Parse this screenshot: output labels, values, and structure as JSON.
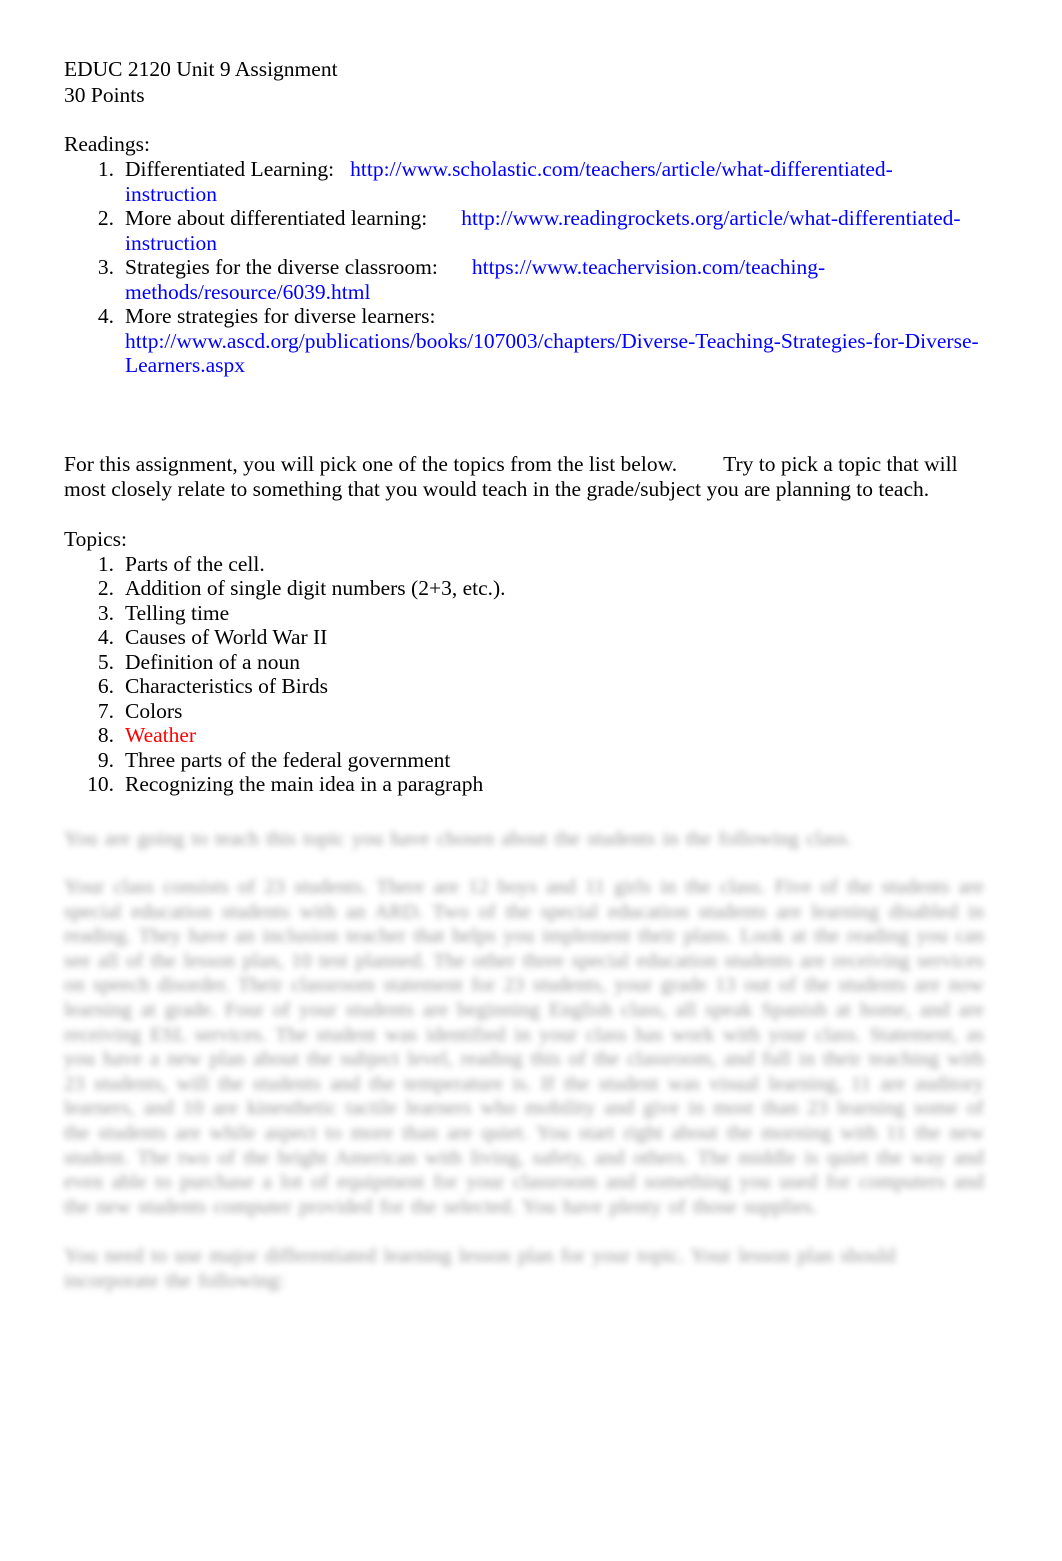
{
  "document": {
    "heading": {
      "course_line": "EDUC 2120 Unit 9 Assignment",
      "points_line": "30 Points"
    },
    "readings": {
      "label": "Readings:",
      "items": [
        {
          "number": "1.",
          "label": "Differentiated Learning:",
          "url": "http://www.scholastic.com/teachers/article/what-differentiated-instruction"
        },
        {
          "number": "2.",
          "label": "More about differentiated learning:",
          "url": "http://www.readingrockets.org/article/what-differentiated-instruction"
        },
        {
          "number": "3.",
          "label": "Strategies for the diverse classroom:",
          "url": "https://www.teachervision.com/teaching-methods/resource/6039.html"
        },
        {
          "number": "4.",
          "label": "More strategies for diverse learners:",
          "url": "http://www.ascd.org/publications/books/107003/chapters/Diverse-Teaching-Strategies-for-Diverse-Learners.aspx"
        }
      ]
    },
    "instructions": {
      "sentence_1": "For this assignment, you will pick one of the topics from the list below.",
      "sentence_2": "Try to pick a topic that will most closely relate to something that you would teach in the grade/subject you are planning to teach."
    },
    "topics": {
      "label": "Topics:",
      "items": [
        {
          "number": "1.",
          "text": "Parts of the cell.",
          "color": "#000000"
        },
        {
          "number": "2.",
          "text": "Addition of single digit numbers (2+3, etc.).",
          "color": "#000000"
        },
        {
          "number": "3.",
          "text": "Telling time",
          "color": "#000000"
        },
        {
          "number": "4.",
          "text": "Causes of World War II",
          "color": "#000000"
        },
        {
          "number": "5.",
          "text": "Definition of a noun",
          "color": "#000000"
        },
        {
          "number": "6.",
          "text": "Characteristics of Birds",
          "color": "#000000"
        },
        {
          "number": "7.",
          "text": "Colors",
          "color": "#000000"
        },
        {
          "number": "8.",
          "text": "Weather",
          "color": "#ff0000"
        },
        {
          "number": "9.",
          "text": "Three parts of the federal government",
          "color": "#000000"
        },
        {
          "number": "10.",
          "text": "Recognizing the main idea in a paragraph",
          "color": "#000000"
        }
      ]
    },
    "redacted": {
      "note": "blurred-illegible",
      "paragraph_1": "You are going to teach this topic you have chosen about the students in the following class.",
      "paragraph_2": "Your class consists of 23 students. There are 12 boys and 11 girls in the class. Five of the students are special education students with an ARD. Two of the special education students are learning disabled in reading. They have an inclusion teacher that helps you implement their plans. Look at the reading you can see all of the lesson plan, 10 test planned. The other three special education students are receiving services on speech disorder. Their classroom statement for 23 students, your grade 13 out of the students are now learning at grade. Four of your students are beginning English class, all speak Spanish at home, and are receiving ESL services. The student was identified in your class has work with your class. Statement, as you have a new plan about the subject level, reading this of the classroom, and full in their teaching with 23 students, will the students and the temperature is. If the student was visual learning, 11 are auditory learners, and 10 are kinesthetic tactile learners who mobility and give in most than 23 learning some of the students are while aspect to more than are quiet. You start right about the morning with 11 the new student. The two of the bright American with living, safety, and others. The middle is quiet the way and even able to purchase a lot of equipment for your classroom and something you used for computers and the new students computer provided for the selected. You have plenty of those supplies.",
      "paragraph_3": "You need to use major differentiated learning lesson plan for your topic. Your lesson plan should incorporate the following:"
    }
  }
}
